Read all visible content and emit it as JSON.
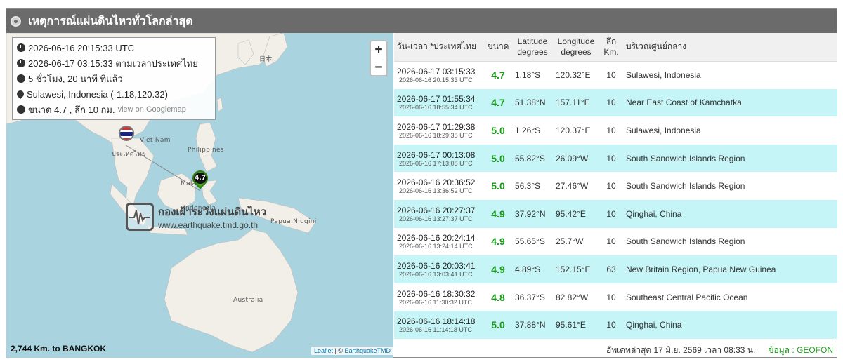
{
  "header": {
    "title": "เหตุการณ์แผ่นดินไหวทั่วโลกล่าสุด"
  },
  "info": {
    "utc": "2026-06-16 20:15:33 UTC",
    "thai": "2026-06-17 03:15:33 ตามเวลาประเทศไทย",
    "ago": "5 ชั่วโมง, 20 นาที ที่แล้ว",
    "place": "Sulawesi, Indonesia (-1.18,120.32)",
    "mag": "ขนาด 4.7 , ลึก 10 กม.",
    "gmap": "view on Googlemap"
  },
  "map": {
    "labels": {
      "japan": "日本",
      "vietnam": "Viet Nam",
      "thailand": "ประเทศไทย",
      "philippines": "Philippines",
      "malaysia": "Mala",
      "indonesia": "Indonesia",
      "papua": "Papua Niugini",
      "australia": "Australia"
    },
    "marker_mag": "4.7",
    "zoom_in": "+",
    "zoom_out": "−",
    "distance": "2,744 Km. to BANGKOK",
    "attrib_leaflet": "Leaflet",
    "attrib_sep": " | © ",
    "attrib_tmd": "EarthquakeTMD",
    "watermark_title": "กองเฝ้าระวังแผ่นดินไหว",
    "watermark_url": "www.earthquake.tmd.go.th"
  },
  "table": {
    "headers": {
      "time": "วัน-เวลา *ประเทศไทย",
      "mag": "ขนาด",
      "lat": "Latitude degrees",
      "lon": "Longitude degrees",
      "depth": "ลึก Km.",
      "region": "บริเวณศูนย์กลาง"
    },
    "rows": [
      {
        "thai": "2026-06-17 03:15:33",
        "utc": "2026-06-16 20:15:33 UTC",
        "mag": "4.7",
        "lat": "1.18°S",
        "lon": "120.32°E",
        "depth": "10",
        "region": "Sulawesi, Indonesia"
      },
      {
        "thai": "2026-06-17 01:55:34",
        "utc": "2026-06-16 18:55:34 UTC",
        "mag": "4.7",
        "lat": "51.38°N",
        "lon": "157.11°E",
        "depth": "10",
        "region": "Near East Coast of Kamchatka"
      },
      {
        "thai": "2026-06-17 01:29:38",
        "utc": "2026-06-16 18:29:38 UTC",
        "mag": "5.0",
        "lat": "1.26°S",
        "lon": "120.37°E",
        "depth": "10",
        "region": "Sulawesi, Indonesia"
      },
      {
        "thai": "2026-06-17 00:13:08",
        "utc": "2026-06-16 17:13:08 UTC",
        "mag": "5.0",
        "lat": "55.82°S",
        "lon": "26.09°W",
        "depth": "10",
        "region": "South Sandwich Islands Region"
      },
      {
        "thai": "2026-06-16 20:36:52",
        "utc": "2026-06-16 13:36:52 UTC",
        "mag": "5.0",
        "lat": "56.3°S",
        "lon": "27.46°W",
        "depth": "10",
        "region": "South Sandwich Islands Region"
      },
      {
        "thai": "2026-06-16 20:27:37",
        "utc": "2026-06-16 13:27:37 UTC",
        "mag": "4.9",
        "lat": "37.92°N",
        "lon": "95.42°E",
        "depth": "10",
        "region": "Qinghai, China"
      },
      {
        "thai": "2026-06-16 20:24:14",
        "utc": "2026-06-16 13:24:14 UTC",
        "mag": "4.9",
        "lat": "55.65°S",
        "lon": "25.7°W",
        "depth": "10",
        "region": "South Sandwich Islands Region"
      },
      {
        "thai": "2026-06-16 20:03:41",
        "utc": "2026-06-16 13:03:41 UTC",
        "mag": "4.9",
        "lat": "4.89°S",
        "lon": "152.15°E",
        "depth": "63",
        "region": "New Britain Region, Papua New Guinea"
      },
      {
        "thai": "2026-06-16 18:30:32",
        "utc": "2026-06-16 11:30:32 UTC",
        "mag": "4.8",
        "lat": "36.37°S",
        "lon": "82.82°W",
        "depth": "10",
        "region": "Southeast Central Pacific Ocean"
      },
      {
        "thai": "2026-06-16 18:14:18",
        "utc": "2026-06-16 11:14:18 UTC",
        "mag": "5.0",
        "lat": "37.88°N",
        "lon": "95.61°E",
        "depth": "10",
        "region": "Qinghai, China"
      }
    ]
  },
  "footer": {
    "updated": "อัพเดทล่าสุด 17 มิ.ย. 2569 เวลา 08:33 น.",
    "source": "ข้อมูล : GEOFON"
  },
  "colors": {
    "header_bg": "#6b6b6b",
    "row_alt": "#c6f5f7",
    "mag_green": "#1a9a1a",
    "sea": "#a9d3df",
    "land": "#f2efe9"
  }
}
